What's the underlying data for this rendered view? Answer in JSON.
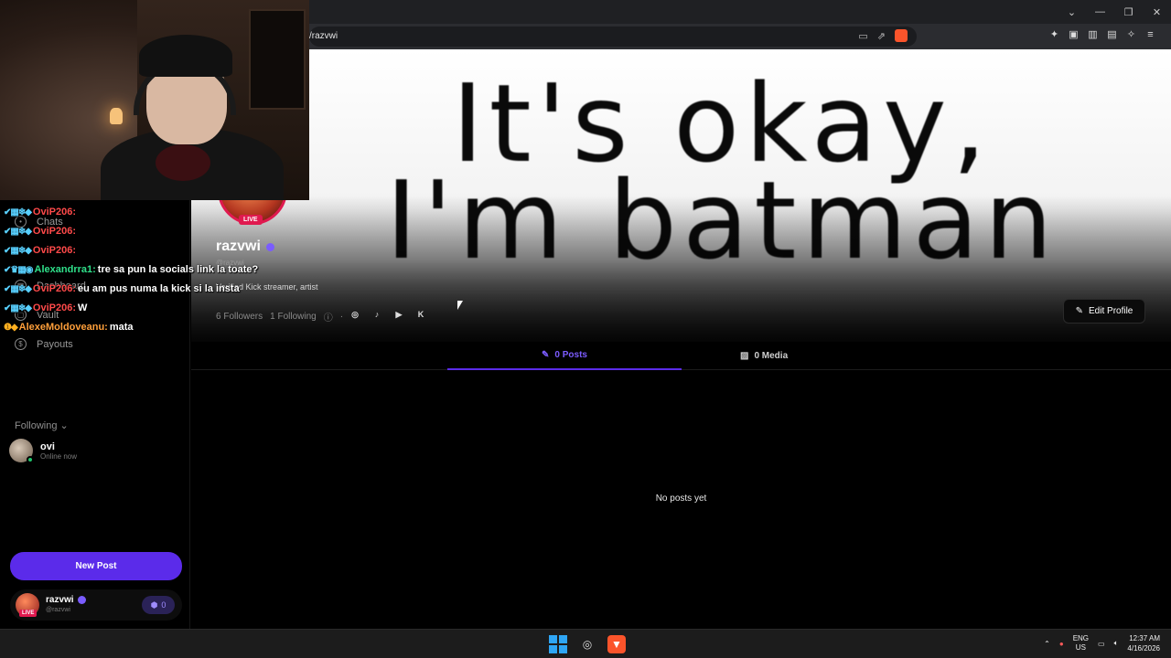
{
  "browser": {
    "url": "/razvwi",
    "window_controls": [
      "⌄",
      "—",
      "❐",
      "✕"
    ],
    "url_icons": [
      "cast-icon",
      "share-icon"
    ],
    "extension_icons": [
      "extensions-icon",
      "tab-icon",
      "sidebar-icon",
      "wallet-icon",
      "leo-icon",
      "menu-icon"
    ]
  },
  "sidebar": {
    "items": [
      {
        "label": "Chats",
        "icon": "chat-icon"
      },
      {
        "label": "Dashboard",
        "icon": "dashboard-icon"
      },
      {
        "label": "Vault",
        "icon": "vault-icon"
      },
      {
        "label": "Payouts",
        "icon": "dollar-icon"
      }
    ],
    "following_label": "Following",
    "following": [
      {
        "name": "ovi",
        "status": "Online now"
      }
    ],
    "new_post_label": "New Post",
    "user": {
      "name": "razvwi",
      "handle": "@razvwi",
      "live": "LIVE",
      "badge_count": "0"
    }
  },
  "profile": {
    "banner_text_line1": "It's okay,",
    "banner_text_line2": "I'm batman",
    "live_tag": "LIVE",
    "name": "razvwi",
    "handle": "@razvwi",
    "bio": "Verified Kick streamer, artist",
    "followers": "6 Followers",
    "following": "1 Following",
    "socials": [
      "instagram-icon",
      "tiktok-icon",
      "youtube-icon",
      "kick-icon"
    ],
    "edit_label": "Edit Profile"
  },
  "tabs": [
    {
      "label": "0 Posts",
      "active": true
    },
    {
      "label": "0 Media",
      "active": false
    }
  ],
  "empty_state": "No posts yet",
  "chat": [
    {
      "user": "OviP206:",
      "color": "#ff4a4a",
      "message": ""
    },
    {
      "user": "OviP206:",
      "color": "#ff4a4a",
      "message": ""
    },
    {
      "user": "OviP206:",
      "color": "#ff4a4a",
      "message": ""
    },
    {
      "user": "Alexandrra1:",
      "color": "#2fe08a",
      "message": "tre sa pun la socials link la toate?"
    },
    {
      "user": "OviP206:",
      "color": "#ff4a4a",
      "message": "eu am pus numa la kick si la insta"
    },
    {
      "user": "OviP206:",
      "color": "#ff4a4a",
      "message": "W"
    },
    {
      "user": "AlexeMoldoveanu:",
      "color": "#ff9f3a",
      "message": "mata"
    }
  ],
  "taskbar": {
    "lang_top": "ENG",
    "lang_bottom": "US",
    "time": "12:37 AM",
    "date": "4/16/2026"
  },
  "colors": {
    "accent": "#5b2bea",
    "live": "#e0194f",
    "tab_active": "#7c5cff"
  }
}
